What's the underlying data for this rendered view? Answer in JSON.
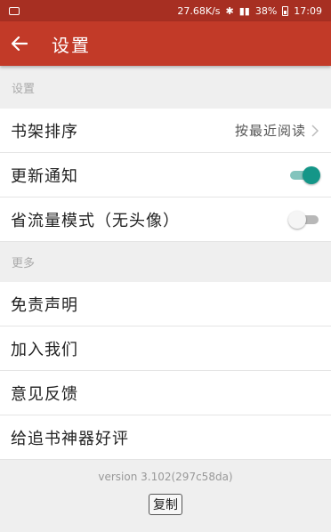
{
  "status_bar": {
    "speed": "27.68K/s",
    "battery": "38%",
    "time": "17:09"
  },
  "app_bar": {
    "title": "设置"
  },
  "settings_section": {
    "header": "设置",
    "shelf_sort": {
      "label": "书架排序",
      "value": "按最近阅读"
    },
    "update_notify": {
      "label": "更新通知",
      "enabled": true
    },
    "data_saver": {
      "label": "省流量模式（无头像）",
      "enabled": false
    }
  },
  "more_section": {
    "header": "更多",
    "items": [
      {
        "label": "免责声明"
      },
      {
        "label": "加入我们"
      },
      {
        "label": "意见反馈"
      },
      {
        "label": "给追书神器好评"
      }
    ]
  },
  "footer": {
    "version": "version 3.102(297c58da)",
    "copy_label": "复制"
  },
  "colors": {
    "status_bar": "#a72f22",
    "app_bar": "#c23a28",
    "toggle_on": "#149688"
  }
}
